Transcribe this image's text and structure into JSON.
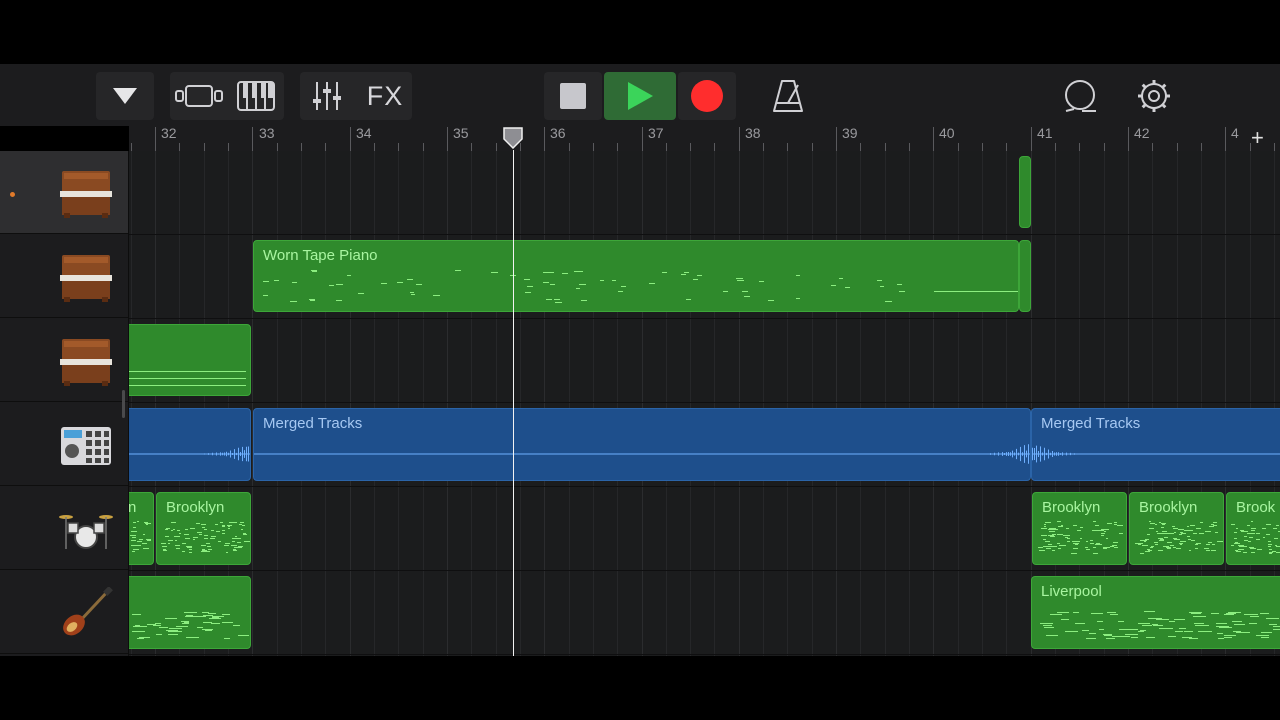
{
  "toolbar": {
    "fx_label": "FX",
    "transport": {
      "play_color": "#34c759",
      "record_color": "#ff2d2d"
    }
  },
  "ruler": {
    "bars": [
      "32",
      "33",
      "34",
      "35",
      "36",
      "37",
      "38",
      "39",
      "40",
      "41",
      "42",
      "4"
    ],
    "add_label": "+"
  },
  "tracks": [
    {
      "instrument": "upright-piano",
      "selected": true
    },
    {
      "instrument": "upright-piano"
    },
    {
      "instrument": "upright-piano"
    },
    {
      "instrument": "drum-machine"
    },
    {
      "instrument": "drum-kit"
    },
    {
      "instrument": "bass-guitar"
    }
  ],
  "regions": [
    {
      "track": 0,
      "type": "midi",
      "label": ""
    },
    {
      "track": 1,
      "type": "midi",
      "label": "Worn Tape Piano"
    },
    {
      "track": 1,
      "type": "midi",
      "label": ""
    },
    {
      "track": 2,
      "type": "midi",
      "label": ""
    },
    {
      "track": 3,
      "type": "audio",
      "label": ""
    },
    {
      "track": 3,
      "type": "audio",
      "label": "Merged Tracks"
    },
    {
      "track": 3,
      "type": "audio",
      "label": "Merged Tracks"
    },
    {
      "track": 4,
      "type": "drums",
      "label": "n"
    },
    {
      "track": 4,
      "type": "drums",
      "label": "Brooklyn"
    },
    {
      "track": 4,
      "type": "drums",
      "label": "Brooklyn"
    },
    {
      "track": 4,
      "type": "drums",
      "label": "Brooklyn"
    },
    {
      "track": 4,
      "type": "drums",
      "label": "Brook"
    },
    {
      "track": 5,
      "type": "midi",
      "label": ""
    },
    {
      "track": 5,
      "type": "midi",
      "label": "Liverpool"
    }
  ]
}
